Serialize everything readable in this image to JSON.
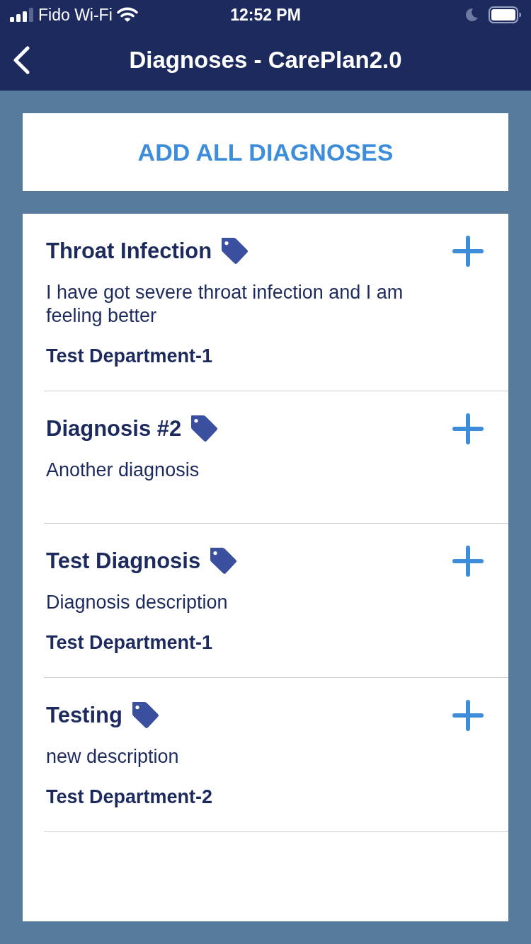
{
  "status_bar": {
    "carrier": "Fido Wi-Fi",
    "time": "12:52 PM"
  },
  "nav_bar": {
    "title": "Diagnoses - CarePlan2.0"
  },
  "add_all_button": {
    "label": "ADD ALL DIAGNOSES"
  },
  "diagnoses": [
    {
      "title": "Throat Infection",
      "description": "I have got severe throat infection and I am feeling better",
      "department": "Test Department-1"
    },
    {
      "title": "Diagnosis #2",
      "description": "Another diagnosis"
    },
    {
      "title": "Test Diagnosis",
      "description": "Diagnosis description",
      "department": "Test Department-1"
    },
    {
      "title": "Testing",
      "description": "new description",
      "department": "Test Department-2"
    }
  ]
}
